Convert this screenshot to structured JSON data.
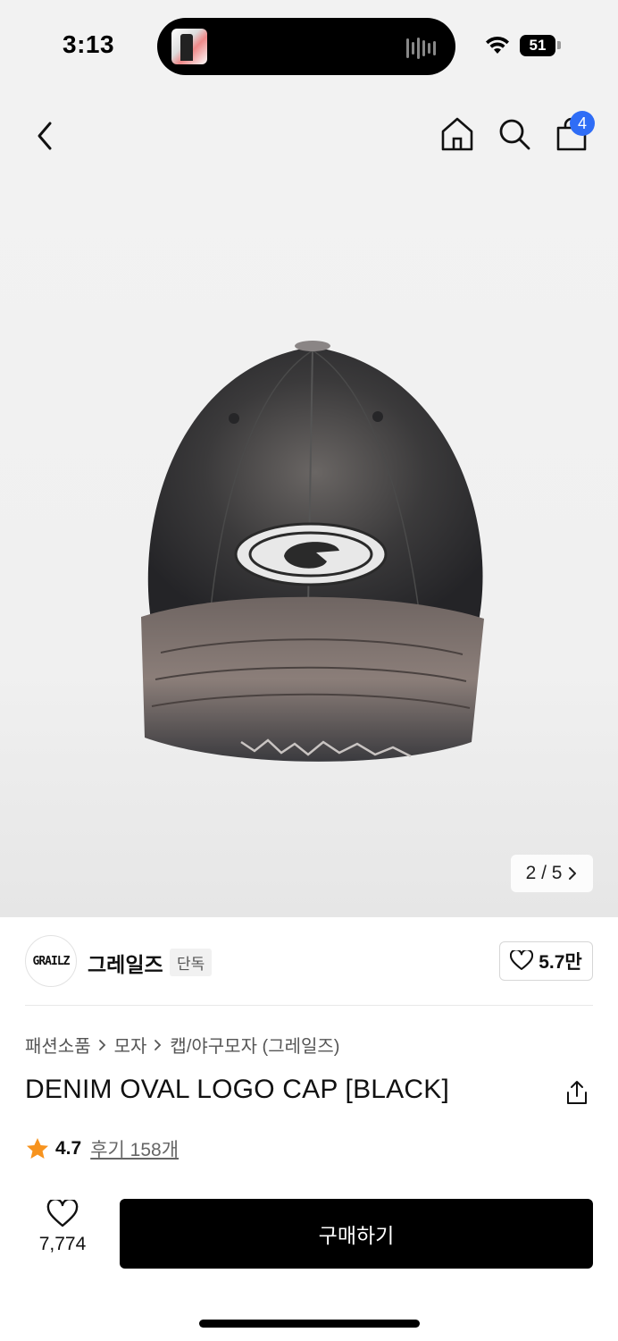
{
  "status_bar": {
    "time": "3:13",
    "battery": "51"
  },
  "header": {
    "cart_badge": "4",
    "icons": [
      "back-icon",
      "home-icon",
      "search-icon",
      "shopping-bag-icon"
    ]
  },
  "gallery": {
    "page": "2 / 5"
  },
  "brand": {
    "logo_text": "GRAILZ",
    "name": "그레일즈",
    "tag": "단독",
    "like_count": "5.7만"
  },
  "breadcrumb": [
    "패션소품",
    "모자",
    "캡/야구모자 (그레일즈)"
  ],
  "product": {
    "title": "DENIM OVAL LOGO CAP [BLACK]",
    "rating": "4.7",
    "reviews": "후기 158개"
  },
  "actions": {
    "wish_count": "7,774",
    "buy_label": "구매하기"
  },
  "colors": {
    "accent_badge": "#2f6df6",
    "buy_button": "#000000",
    "star": "#f7931e"
  }
}
